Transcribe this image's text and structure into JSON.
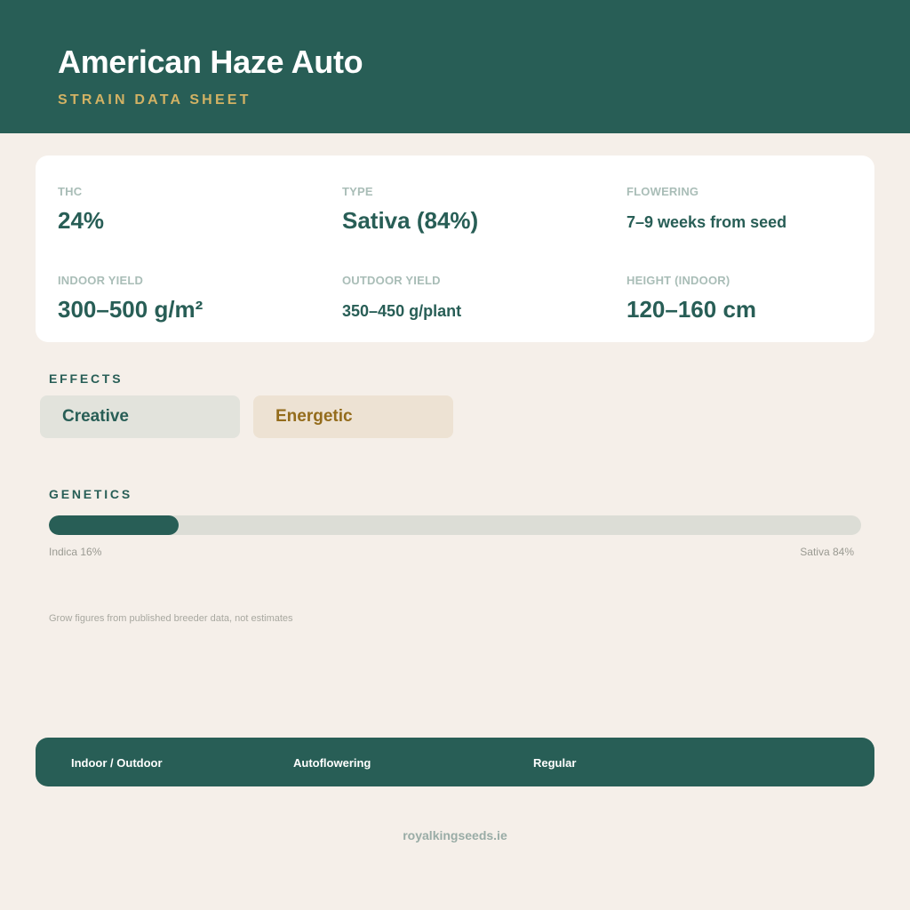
{
  "header": {
    "title": "American Haze Auto",
    "subtitle": "STRAIN DATA SHEET"
  },
  "stats": [
    {
      "label": "THC",
      "value": "24%"
    },
    {
      "label": "TYPE",
      "value": "Sativa (84%)"
    },
    {
      "label": "FLOWERING",
      "value": "7–9 weeks from seed"
    },
    {
      "label": "INDOOR YIELD",
      "value": "300–500 g/m²"
    },
    {
      "label": "OUTDOOR YIELD",
      "value": "350–450 g/plant"
    },
    {
      "label": "HEIGHT (INDOOR)",
      "value": "120–160 cm"
    }
  ],
  "effects": {
    "title": "EFFECTS",
    "items": [
      "Creative",
      "Energetic"
    ]
  },
  "genetics": {
    "title": "GENETICS",
    "indica_percent": 16,
    "sativa_percent": 84,
    "indica_label": "Indica 16%",
    "sativa_label": "Sativa 84%"
  },
  "note": "Grow figures from published breeder data, not estimates",
  "footer": {
    "items": [
      "Indoor / Outdoor",
      "Autoflowering",
      "Regular"
    ]
  },
  "site": "royalkingseeds.ie",
  "colors": {
    "primary": "#285e56",
    "accent": "#d2b264",
    "background": "#f5efe9",
    "energetic": "#946c1c"
  }
}
